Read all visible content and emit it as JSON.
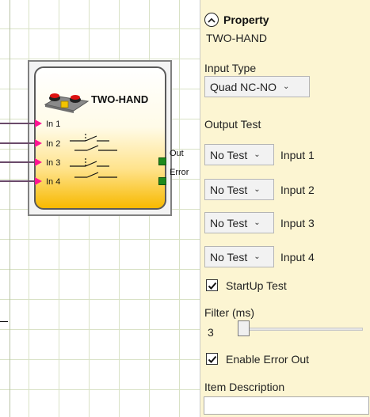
{
  "canvas": {
    "block": {
      "title": "TWO-HAND",
      "inputs": [
        "In 1",
        "In 2",
        "In 3",
        "In 4"
      ],
      "outputs": [
        "Out",
        "Error"
      ]
    }
  },
  "panel": {
    "header": "Property",
    "component_name": "TWO-HAND",
    "input_type_label": "Input Type",
    "input_type_value": "Quad NC-NO",
    "output_test_label": "Output Test",
    "output_tests": [
      {
        "value": "No Test",
        "label": "Input 1"
      },
      {
        "value": "No Test",
        "label": "Input 2"
      },
      {
        "value": "No Test",
        "label": "Input 3"
      },
      {
        "value": "No Test",
        "label": "Input 4"
      }
    ],
    "startup_test_label": "StartUp Test",
    "startup_test_checked": true,
    "filter_label": "Filter (ms)",
    "filter_value": "3",
    "enable_error_out_label": "Enable Error Out",
    "enable_error_out_checked": true,
    "item_description_label": "Item Description",
    "item_description_value": ""
  },
  "colors": {
    "panel_bg": "#fcf5d2",
    "input_arrow": "#ff1493",
    "output_port": "#1d8a1d",
    "block_gradient_bottom": "#f7b900"
  }
}
